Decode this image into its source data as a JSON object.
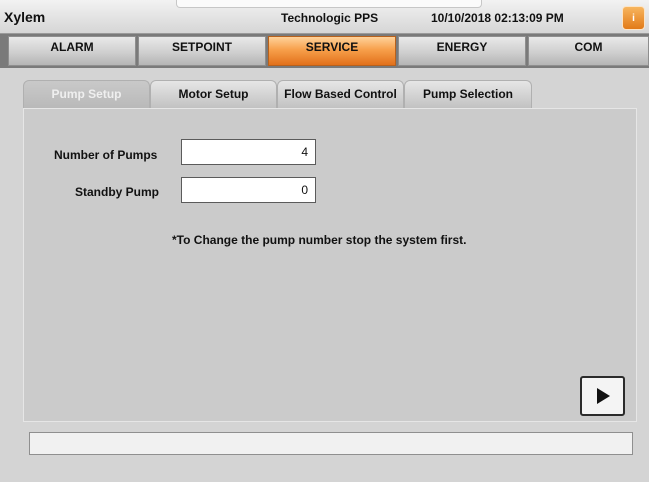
{
  "header": {
    "app_name": "Xylem",
    "product_name": "Technologic PPS",
    "datetime": "10/10/2018 02:13:09 PM",
    "info_icon": "info-icon",
    "info_label": "i"
  },
  "nav": {
    "tabs": [
      {
        "label": "ALARM",
        "active": false
      },
      {
        "label": "SETPOINT",
        "active": false
      },
      {
        "label": "SERVICE",
        "active": true
      },
      {
        "label": "ENERGY",
        "active": false
      },
      {
        "label": "COM",
        "active": false
      }
    ]
  },
  "subtabs": [
    {
      "label": "Pump Setup",
      "active": true
    },
    {
      "label": "Motor Setup",
      "active": false
    },
    {
      "label": "Flow Based Control",
      "active": false
    },
    {
      "label": "Pump Selection",
      "active": false
    }
  ],
  "form": {
    "number_of_pumps": {
      "label": "Number of Pumps",
      "value": "4"
    },
    "standby_pump": {
      "label": "Standby Pump",
      "value": "0"
    },
    "notice": "*To Change the pump number stop the system first."
  },
  "next_button": {
    "icon": "play-arrow-icon"
  },
  "status_bar": {
    "text": ""
  },
  "colors": {
    "accent": "#f08a2b",
    "nav_background": "#7a7a7a",
    "panel_background": "#cbcbcb"
  }
}
